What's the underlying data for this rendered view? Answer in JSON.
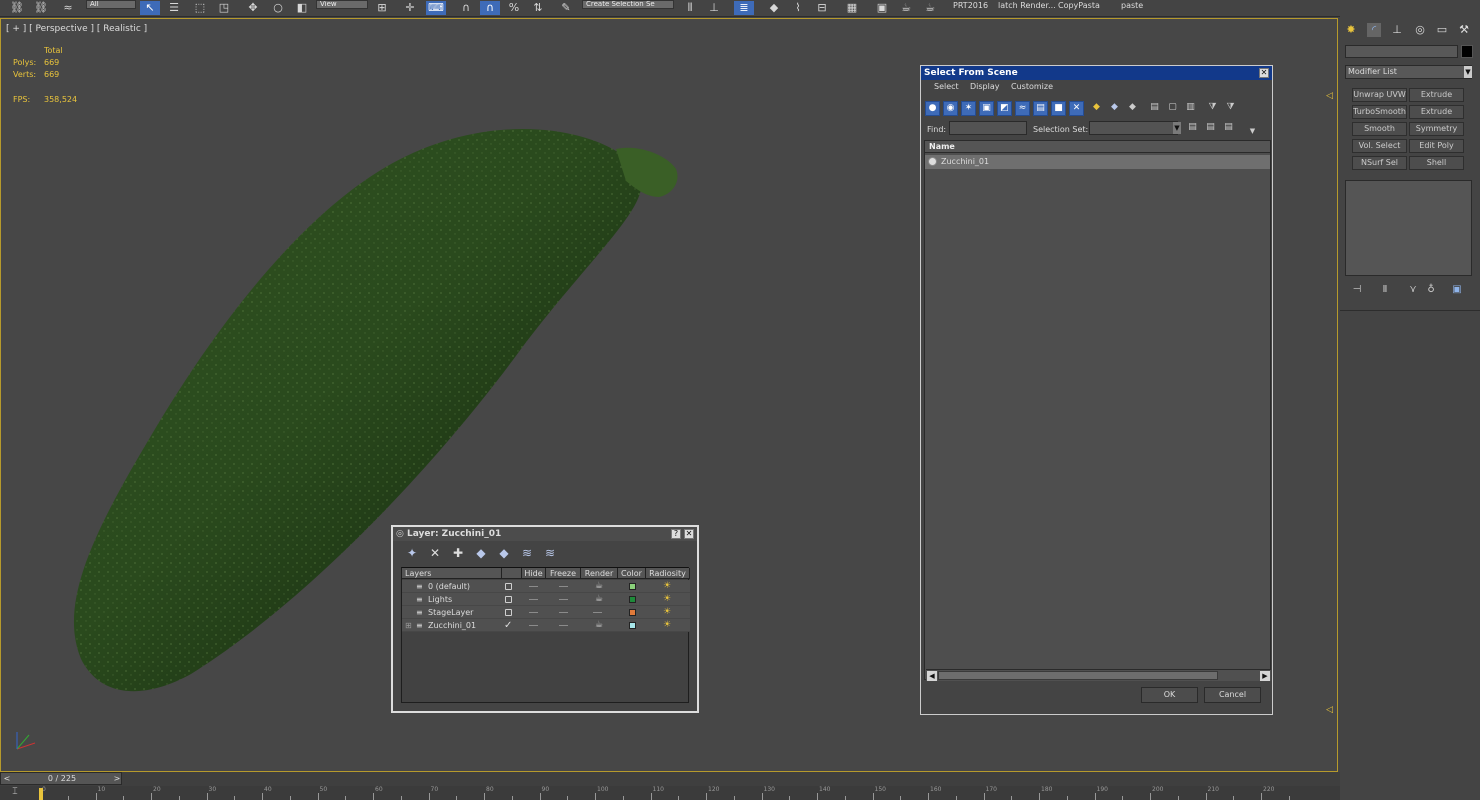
{
  "toolbar": {
    "filter_value": "All",
    "refcoord_value": "View",
    "selection_set_placeholder": "Create Selection Se",
    "labels": [
      "PRT2016",
      "latch Render...",
      "CopyPasta",
      "paste"
    ]
  },
  "viewport": {
    "label": "[ + ] [ Perspective ] [ Realistic ]",
    "stats_header": "Total",
    "polys_label": "Polys:",
    "polys_value": "669",
    "verts_label": "Verts:",
    "verts_value": "669",
    "fps_label": "FPS:",
    "fps_value": "358,524"
  },
  "layer_dialog": {
    "title": "Layer: Zucchini_01",
    "help_label": "?",
    "close_label": "✕",
    "columns": {
      "layers": "Layers",
      "hide": "Hide",
      "freeze": "Freeze",
      "render": "Render",
      "color": "Color",
      "radiosity": "Radiosity"
    },
    "rows": [
      {
        "name": "0 (default)",
        "color": "#8ad07a",
        "current": false
      },
      {
        "name": "Lights",
        "color": "#1f8a3a",
        "current": false
      },
      {
        "name": "StageLayer",
        "color": "#e07a3a",
        "current": false
      },
      {
        "name": "Zucchini_01",
        "color": "#a7e6ea",
        "current": true
      }
    ]
  },
  "select_dialog": {
    "title": "Select From Scene",
    "close_label": "✕",
    "menu": [
      "Select",
      "Display",
      "Customize"
    ],
    "find_label": "Find:",
    "find_value": "",
    "selection_set_label": "Selection Set:",
    "column_name": "Name",
    "items": [
      "Zucchini_01"
    ],
    "ok_label": "OK",
    "cancel_label": "Cancel"
  },
  "command_panel": {
    "modifier_list": "Modifier List",
    "modifiers": [
      "Unwrap UVW",
      "Extrude",
      "TurboSmooth",
      "Extrude",
      "Smooth",
      "Symmetry",
      "Vol. Select",
      "Edit Poly",
      "NSurf Sel",
      "Shell"
    ]
  },
  "timeline": {
    "frame_label": "0 / 225",
    "prev": "<",
    "next": ">",
    "ticks": [
      "0",
      "10",
      "20",
      "30",
      "40",
      "50",
      "60",
      "70",
      "80",
      "90",
      "100",
      "110",
      "120",
      "130",
      "140",
      "150",
      "160",
      "170",
      "180",
      "190",
      "200",
      "210",
      "220"
    ]
  },
  "colors": {
    "accent": "#3e6bb8",
    "dialog_title": "#12398a",
    "viewport_border": "#b69a2c",
    "stat_text": "#e9c43c"
  }
}
